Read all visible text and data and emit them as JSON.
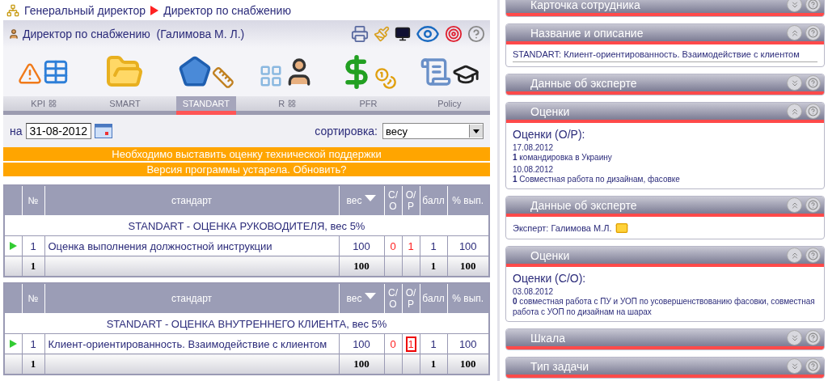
{
  "breadcrumb": [
    {
      "label": "Генеральный директор"
    },
    {
      "label": "Директор по снабжению"
    }
  ],
  "header": {
    "title": "Директор по снабжению  (Галимова М. Л.)"
  },
  "modules": [
    {
      "kind": "kpi",
      "label": "KPI",
      "grid": true,
      "selected": false
    },
    {
      "kind": "smart",
      "label": "SMART",
      "grid": false,
      "selected": false
    },
    {
      "kind": "standart",
      "label": "STANDART",
      "grid": false,
      "selected": true
    },
    {
      "kind": "rating",
      "label": "R",
      "grid": true,
      "selected": false
    },
    {
      "kind": "pfr",
      "label": "PFR",
      "grid": false,
      "selected": false
    },
    {
      "kind": "policy",
      "label": "Policy",
      "grid": false,
      "selected": false
    }
  ],
  "date_filter": {
    "label": "на",
    "value": "31-08-2012"
  },
  "sort": {
    "label": "сортировка:",
    "value": "весу"
  },
  "notices": [
    "Необходимо выставить оценку технической поддержки",
    "Версия программы устарела. Обновить?"
  ],
  "sections": [
    {
      "columns": [
        {
          "label": "№",
          "sorted": false
        },
        {
          "label": "стандарт",
          "sorted": false
        },
        {
          "label": "вес",
          "sorted": true
        },
        {
          "label": "С/О",
          "sorted": false
        },
        {
          "label": "О/Р",
          "sorted": false
        },
        {
          "label": "балл",
          "sorted": false
        },
        {
          "label": "% вып.",
          "sorted": false
        }
      ],
      "group": "STANDART - ОЦЕНКА РУКОВОДИТЕЛЯ, вес 5%",
      "rows": [
        {
          "no": "1",
          "name": "Оценка выполнения должностной инструкции",
          "weight": "100",
          "so": {
            "text": "0",
            "alert": true,
            "boxed": false
          },
          "op": {
            "text": "1",
            "alert": true,
            "boxed": false
          },
          "score": "1",
          "pct": "100"
        }
      ],
      "total": {
        "no": "1",
        "weight": "100",
        "score": "1",
        "pct": "100"
      }
    },
    {
      "columns": [
        {
          "label": "№",
          "sorted": false
        },
        {
          "label": "стандарт",
          "sorted": false
        },
        {
          "label": "вес",
          "sorted": true
        },
        {
          "label": "С/О",
          "sorted": false
        },
        {
          "label": "О/Р",
          "sorted": false
        },
        {
          "label": "балл",
          "sorted": false
        },
        {
          "label": "% вып.",
          "sorted": false
        }
      ],
      "group": "STANDART - ОЦЕНКА ВНУТРЕННЕГО КЛИЕНТА, вес 5%",
      "rows": [
        {
          "no": "1",
          "name": "Клиент-ориентированность. Взаимодействие с клиентом",
          "weight": "100",
          "so": {
            "text": "0",
            "alert": true,
            "boxed": false
          },
          "op": {
            "text": "1",
            "alert": true,
            "boxed": true
          },
          "score": "1",
          "pct": "100"
        }
      ],
      "total": {
        "no": "1",
        "weight": "100",
        "score": "1",
        "pct": "100"
      }
    }
  ],
  "panels": [
    {
      "title": "Карточка сотрудника",
      "expanded": false
    },
    {
      "kind": "text",
      "title": "Название и описание",
      "expanded": true,
      "text": "STANDART: Клиент-ориентированность. Взаимодействие с клиентом"
    },
    {
      "title": "Данные об эксперте",
      "expanded": false
    },
    {
      "kind": "ratings",
      "title": "Оценки",
      "expanded": true,
      "heading": "Оценки (О/Р):",
      "entries": [
        {
          "date": "17.08.2012",
          "score": "1",
          "text": "командировка в Украину"
        },
        {
          "date": "10.08.2012",
          "score": "1",
          "text": "Совместная работа по дизайнам, фасовке"
        }
      ]
    },
    {
      "kind": "expert",
      "title": "Данные об эксперте",
      "expanded": true,
      "text": "Эксперт: Галимова М.Л."
    },
    {
      "kind": "ratings",
      "title": "Оценки",
      "expanded": true,
      "heading": "Оценки (С/О):",
      "entries": [
        {
          "date": "03.08.2012",
          "score": "0",
          "text": "совместная работа с ПУ и УОП по усовершенствованию фасовки, совместная работа с УОП по дизайнам на шарах"
        }
      ]
    },
    {
      "title": "Шкала",
      "expanded": false
    },
    {
      "title": "Тип задачи",
      "expanded": false
    }
  ]
}
